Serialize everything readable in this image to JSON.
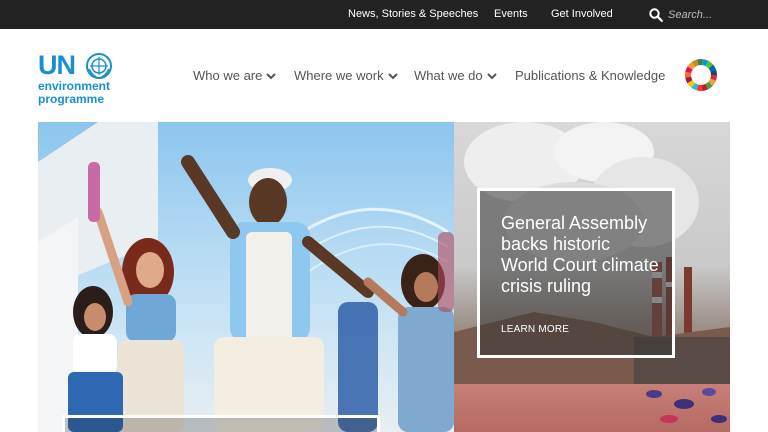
{
  "topbar": {
    "links": [
      "News, Stories & Speeches",
      "Events",
      "Get Involved"
    ],
    "search_placeholder": "Search..."
  },
  "logo": {
    "mark": "UN",
    "line1": "environment",
    "line2": "programme"
  },
  "nav": {
    "items": [
      {
        "label": "Who we are",
        "has_dropdown": true
      },
      {
        "label": "Where we work",
        "has_dropdown": true
      },
      {
        "label": "What we do",
        "has_dropdown": true
      },
      {
        "label": "Publications & Knowledge",
        "has_dropdown": false
      }
    ]
  },
  "hero": {
    "feature_story": {
      "title": "General Assembly backs historic World Court climate crisis ruling",
      "link_label": "LEARN MORE"
    }
  },
  "colors": {
    "topbar_bg": "#222222",
    "brand_blue": "#1a8fd0",
    "nav_text": "#555555"
  }
}
